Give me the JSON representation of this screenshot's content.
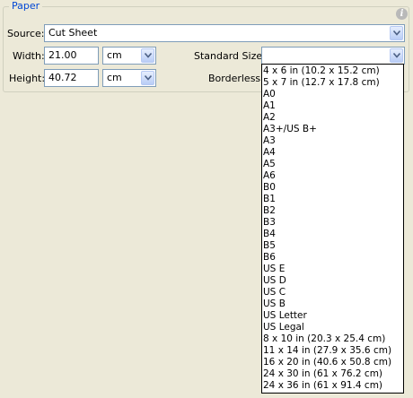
{
  "paper_group": {
    "title": "Paper",
    "info_icon": "i"
  },
  "source": {
    "label": "Source:",
    "value": "Cut Sheet"
  },
  "width": {
    "label": "Width:",
    "value": "21.00",
    "unit": "cm"
  },
  "height": {
    "label": "Height:",
    "value": "40.72",
    "unit": "cm"
  },
  "standard_size": {
    "label": "Standard Size:",
    "value": ""
  },
  "borderless": {
    "label": "Borderless:"
  },
  "standard_size_options": [
    "4 x 6 in (10.2 x 15.2 cm)",
    "5 x 7 in (12.7 x 17.8 cm)",
    "A0",
    "A1",
    "A2",
    "A3+/US B+",
    "A3",
    "A4",
    "A5",
    "A6",
    "B0",
    "B1",
    "B2",
    "B3",
    "B4",
    "B5",
    "B6",
    "US E",
    "US D",
    "US C",
    "US B",
    "US Letter",
    "US Legal",
    "8 x 10 in (20.3 x 25.4 cm)",
    "11 x 14 in (27.9 x 35.6 cm)",
    "16 x 20 in (40.6 x 50.8 cm)",
    "24 x 30 in (61 x 76.2 cm)",
    "24 x 36 in (61 x 91.4 cm)"
  ],
  "colors": {
    "background": "#ece9d8",
    "group_title": "#0046d5",
    "field_border": "#7f9db9"
  }
}
